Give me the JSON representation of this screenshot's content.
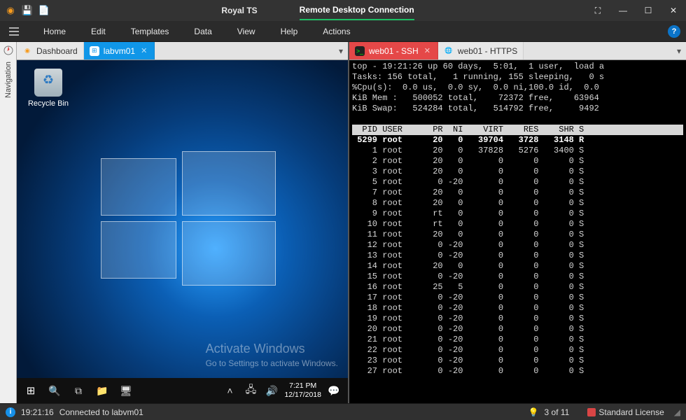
{
  "titlebar": {
    "app_title": "Royal TS",
    "active_conn": "Remote Desktop Connection"
  },
  "menu": {
    "items": [
      "Home",
      "Edit",
      "Templates",
      "Data",
      "View",
      "Help",
      "Actions"
    ]
  },
  "nav_rail": {
    "label": "Navigation"
  },
  "left_tabs": {
    "dashboard": "Dashboard",
    "rdp": "labvm01"
  },
  "right_tabs": {
    "ssh": "web01 - SSH",
    "https": "web01 - HTTPS"
  },
  "desktop": {
    "recycle_label": "Recycle Bin",
    "activate_title": "Activate Windows",
    "activate_body": "Go to Settings to activate Windows.",
    "taskbar_time": "7:21 PM",
    "taskbar_date": "12/17/2018"
  },
  "terminal": {
    "line1": "top - 19:21:26 up 60 days,  5:01,  1 user,  load a",
    "line2": "Tasks: 156 total,   1 running, 155 sleeping,   0 s",
    "line3": "%Cpu(s):  0.0 us,  0.0 sy,  0.0 ni,100.0 id,  0.0 ",
    "line4": "KiB Mem :   500052 total,    72372 free,    63964",
    "line5": "KiB Swap:   524284 total,   514792 free,     9492",
    "header": "  PID USER      PR  NI    VIRT    RES    SHR S   ",
    "rows": [
      " 5299 root      20   0   39704   3728   3148 R   ",
      "    1 root      20   0   37828   5276   3400 S   ",
      "    2 root      20   0       0      0      0 S   ",
      "    3 root      20   0       0      0      0 S   ",
      "    5 root       0 -20       0      0      0 S   ",
      "    7 root      20   0       0      0      0 S   ",
      "    8 root      20   0       0      0      0 S   ",
      "    9 root      rt   0       0      0      0 S   ",
      "   10 root      rt   0       0      0      0 S   ",
      "   11 root      20   0       0      0      0 S   ",
      "   12 root       0 -20       0      0      0 S   ",
      "   13 root       0 -20       0      0      0 S   ",
      "   14 root      20   0       0      0      0 S   ",
      "   15 root       0 -20       0      0      0 S   ",
      "   16 root      25   5       0      0      0 S   ",
      "   17 root       0 -20       0      0      0 S   ",
      "   18 root       0 -20       0      0      0 S   ",
      "   19 root       0 -20       0      0      0 S   ",
      "   20 root       0 -20       0      0      0 S   ",
      "   21 root       0 -20       0      0      0 S   ",
      "   22 root       0 -20       0      0      0 S   ",
      "   23 root       0 -20       0      0      0 S   ",
      "   27 root       0 -20       0      0      0 S   "
    ]
  },
  "status": {
    "time": "19:21:16",
    "msg": "Connected to labvm01",
    "pager": "3 of 11",
    "license": "Standard License"
  }
}
